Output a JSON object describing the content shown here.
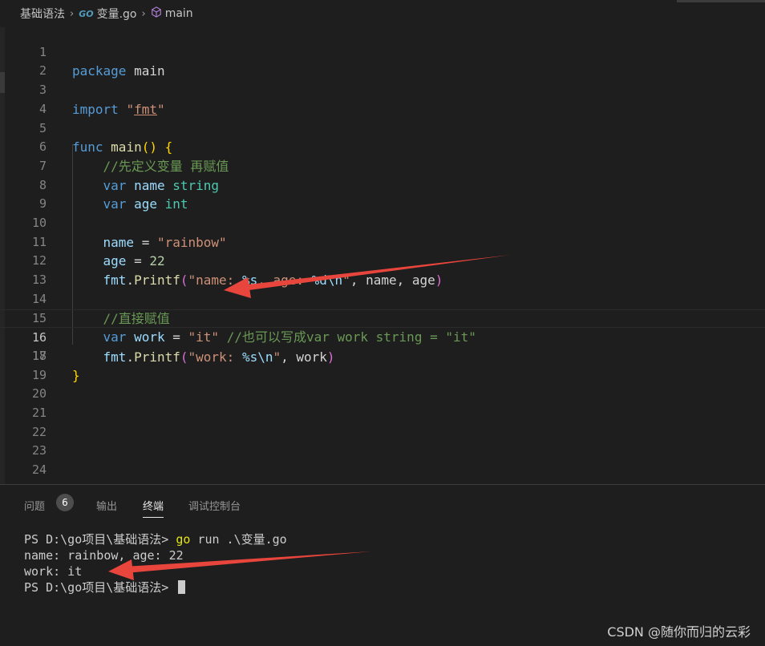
{
  "breadcrumb": {
    "folder": "基础语法",
    "go_badge": "GO",
    "file": "变量.go",
    "symbol": "main"
  },
  "editor": {
    "line_numbers": [
      "1",
      "2",
      "3",
      "4",
      "5",
      "6",
      "7",
      "8",
      "9",
      "10",
      "11",
      "12",
      "13",
      "14",
      "15",
      "16",
      "17",
      "18",
      "19",
      "20",
      "21",
      "22",
      "23",
      "24"
    ],
    "active_line": 16,
    "code": {
      "l1_kw": "package",
      "l1_name": "main",
      "l3_kw": "import",
      "l3_q1": "\"",
      "l3_pkg": "fmt",
      "l3_q2": "\"",
      "l5_kw": "func",
      "l5_fn": "main",
      "l5_paren": "()",
      "l5_brace": "{",
      "l6_comment": "//先定义变量 再赋值",
      "l7_kw": "var",
      "l7_var": "name",
      "l7_type": "string",
      "l8_kw": "var",
      "l8_var": "age",
      "l8_type": "int",
      "l10_var": "name",
      "l10_op": " = ",
      "l10_str": "\"rainbow\"",
      "l11_var": "age",
      "l11_op": " = ",
      "l11_num": "22",
      "l12_pkg": "fmt",
      "l12_dot": ".",
      "l12_fn": "Printf",
      "l12_open": "(",
      "l12_s1": "\"name: ",
      "l12_e1": "%s",
      "l12_s2": ", age: ",
      "l12_e2": "%d\\n",
      "l12_s3": "\"",
      "l12_args": ", name, age",
      "l12_close": ")",
      "l14_comment": "//直接赋值",
      "l15_kw": "var",
      "l15_var": "work",
      "l15_op": " = ",
      "l15_str": "\"it\"",
      "l15_comment": "//也可以写成var work string = \"it\"",
      "l16_pkg": "fmt",
      "l16_dot": ".",
      "l16_fn": "Printf",
      "l16_open": "(",
      "l16_s1": "\"work: ",
      "l16_e1": "%s\\n",
      "l16_s2": "\"",
      "l16_args": ", work",
      "l16_close": ")",
      "l17_brace": "}"
    }
  },
  "panel": {
    "tabs": {
      "problems": "问题",
      "problems_count": "6",
      "output": "输出",
      "terminal": "终端",
      "debug_console": "调试控制台"
    },
    "terminal": {
      "prompt1": "PS D:\\go项目\\基础语法> ",
      "cmd_go": "go",
      "cmd_rest": " run .\\变量.go",
      "out1": "name: rainbow, age: 22",
      "out2": "work: it",
      "prompt2": "PS D:\\go项目\\基础语法> "
    }
  },
  "watermark": "CSDN @随你而归的云彩",
  "colors": {
    "background": "#1e1e1e",
    "keyword": "#569cd6",
    "function": "#dcdcaa",
    "string": "#ce9178",
    "comment": "#6a9955",
    "annotation_arrow": "#e8453c"
  }
}
